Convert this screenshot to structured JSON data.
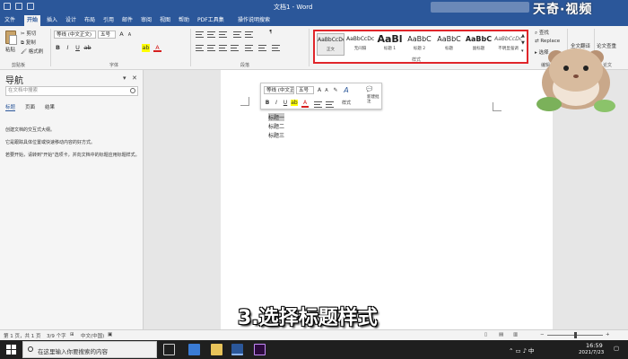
{
  "window": {
    "title": "文档1 - Word",
    "watermark": "天奇·视频"
  },
  "tabs": [
    "文件",
    "开始",
    "插入",
    "设计",
    "布局",
    "引用",
    "邮件",
    "审阅",
    "视图",
    "帮助",
    "PDF工具集",
    "操作说明搜索"
  ],
  "ribbon": {
    "clipboard": {
      "paste": "粘贴",
      "cut": "剪切",
      "copy": "复制",
      "format_painter": "格式刷",
      "group": "剪贴板"
    },
    "font": {
      "font_name": "等线 (中文正文)",
      "font_size": "五号",
      "group": "字体",
      "bold": "B",
      "italic": "I",
      "underline": "U",
      "grow": "A",
      "shrink": "A",
      "font_color": "A",
      "highlight": "ab"
    },
    "paragraph": {
      "group": "段落"
    },
    "styles": {
      "group": "样式",
      "items": [
        {
          "sample": "AaBbCcDc",
          "name": "正文"
        },
        {
          "sample": "AaBbCcDc",
          "name": "无间隔"
        },
        {
          "sample": "AaBl",
          "name": "标题 1"
        },
        {
          "sample": "AaBbC",
          "name": "标题 2"
        },
        {
          "sample": "AaBbC",
          "name": "标题"
        },
        {
          "sample": "AaBbC",
          "name": "副标题"
        },
        {
          "sample": "AaBbCcDc",
          "name": "不明显强调"
        }
      ]
    },
    "editing": {
      "find": "查找",
      "replace": "Replace",
      "select": "选择",
      "group": "编辑"
    },
    "extras": {
      "full_translate": "全文翻译",
      "full_translate_group": "翻译",
      "paper_check": "论文查重",
      "paper_group": "论文"
    }
  },
  "nav": {
    "title": "导航",
    "search_placeholder": "在文档中搜索",
    "tabs": [
      "标题",
      "页面",
      "结果"
    ],
    "messages": [
      "创建文档的交互式大纲。",
      "它是跟踪具体位置或快速移动内容的好方式。",
      "若要开始，请转到\"开始\"选项卡，并向文档中的标题应用标题样式。"
    ]
  },
  "mini_toolbar": {
    "font_name": "等线 (中文正",
    "font_size": "五号",
    "grow": "A",
    "shrink": "A",
    "styles": "样式",
    "new_comment": "新建批注",
    "bold": "B",
    "italic": "I",
    "underline": "U",
    "font_color": "A",
    "highlight": "ab"
  },
  "document": {
    "lines": [
      "标题一",
      "标题二",
      "标题三"
    ]
  },
  "caption": "3.选择标题样式",
  "status": {
    "page": "第 1 页，共 1 页",
    "words": "3/9 个字",
    "language": "中文(中国)",
    "zoom_level": 0.5
  },
  "taskbar": {
    "search_placeholder": "在这里输入你要搜索的内容",
    "time": "16:59",
    "date": "2021/7/23"
  },
  "colors": {
    "accent": "#2b579a",
    "highlight_box": "#e0262b",
    "font_color": "#d62020",
    "highlight_color": "#ffff00"
  }
}
